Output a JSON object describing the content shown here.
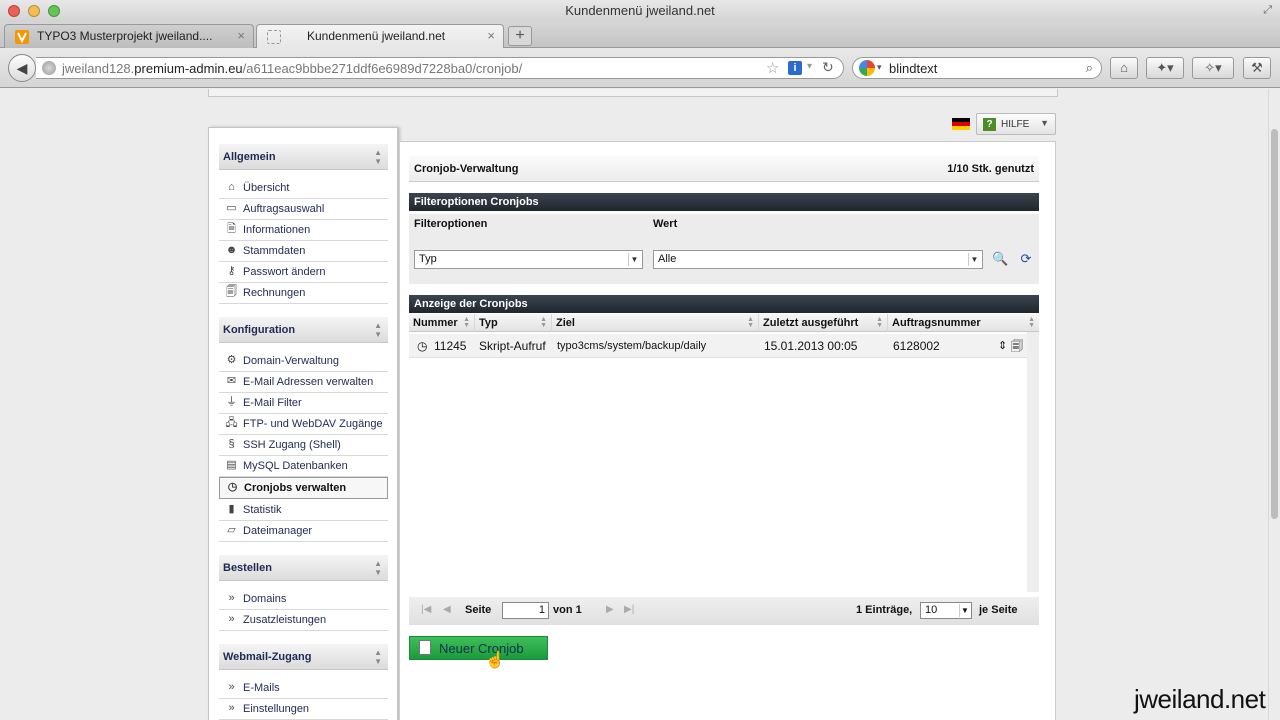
{
  "window": {
    "title": "Kundenmenü jweiland.net"
  },
  "tabs": [
    {
      "label": "TYPO3 Musterprojekt jweiland...."
    },
    {
      "label": "Kundenmenü jweiland.net"
    }
  ],
  "urlbar": {
    "host_pre": "jweiland128.",
    "host_main": "premium-admin.eu",
    "path": "/a611eac9bbbe271ddf6e6989d7228ba0/cronjob/"
  },
  "search": {
    "value": "blindtext"
  },
  "hilfe_label": "HILFE",
  "sidebar": {
    "sections": [
      {
        "title": "Allgemein",
        "items": [
          "Übersicht",
          "Auftragsauswahl",
          "Informationen",
          "Stammdaten",
          "Passwort ändern",
          "Rechnungen"
        ]
      },
      {
        "title": "Konfiguration",
        "items": [
          "Domain-Verwaltung",
          "E-Mail Adressen verwalten",
          "E-Mail Filter",
          "FTP- und WebDAV Zugänge",
          "SSH Zugang (Shell)",
          "MySQL Datenbanken",
          "Cronjobs verwalten",
          "Statistik",
          "Dateimanager"
        ]
      },
      {
        "title": "Bestellen",
        "items": [
          "Domains",
          "Zusatzleistungen"
        ]
      },
      {
        "title": "Webmail-Zugang",
        "items": [
          "E-Mails",
          "Einstellungen"
        ]
      }
    ]
  },
  "main": {
    "title": "Cronjob-Verwaltung",
    "usage": "1/10 Stk. genutzt",
    "filter_title": "Filteroptionen Cronjobs",
    "filter_col1": "Filteroptionen",
    "filter_col2": "Wert",
    "filter_type_value": "Typ",
    "filter_value_value": "Alle",
    "list_title": "Anzeige der Cronjobs",
    "columns": [
      "Nummer",
      "Typ",
      "Ziel",
      "Zuletzt ausgeführt",
      "Auftragsnummer"
    ],
    "rows": [
      {
        "nummer": "11245",
        "typ": "Skript-Aufruf",
        "ziel": "typo3cms/system/backup/daily",
        "zuletzt": "15.01.2013 00:05",
        "auftrag": "6128002"
      }
    ],
    "pager": {
      "seite_label": "Seite",
      "page": "1",
      "von": "von 1",
      "eintraege": "1 Einträge,",
      "per_page": "10",
      "je_seite": "je Seite"
    },
    "new_button": "Neuer Cronjob"
  },
  "watermark": "jweiland.net"
}
